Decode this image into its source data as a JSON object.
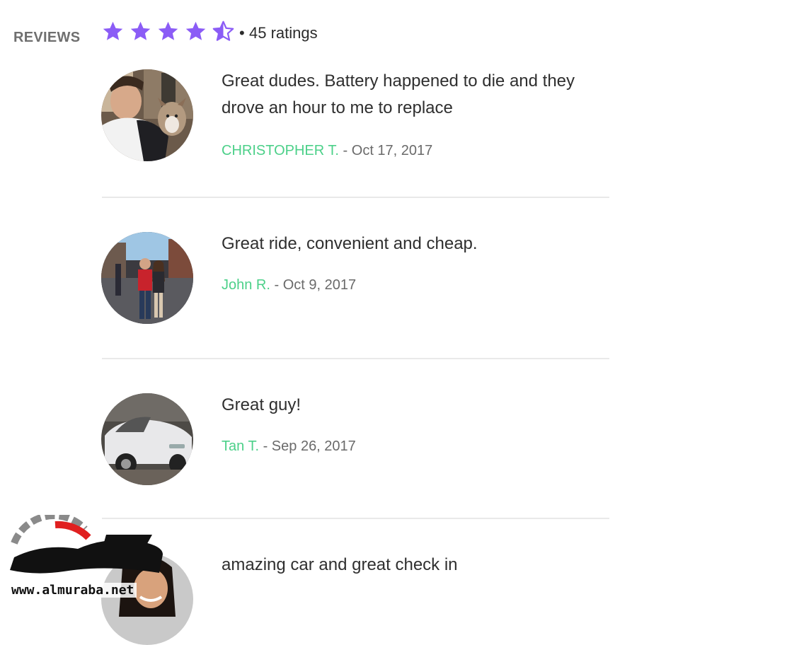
{
  "reviews_section": {
    "label": "REVIEWS",
    "rating": {
      "stars": 4.5,
      "max": 5,
      "color": "#8b5cf6",
      "separator": "•",
      "count_text": "45 ratings"
    }
  },
  "reviews": [
    {
      "avatar_icon": "photo-man-with-dog",
      "text": "Great dudes. Battery happened to die and they drove an hour to me to replace",
      "author": "CHRISTOPHER T.",
      "date": "Oct 17, 2017",
      "dash": "-"
    },
    {
      "avatar_icon": "photo-couple-street",
      "text": "Great ride, convenient and cheap.",
      "author": "John R.",
      "date": "Oct 9, 2017",
      "dash": "-"
    },
    {
      "avatar_icon": "photo-white-convertible-car",
      "text": "Great guy!",
      "author": "Tan T.",
      "date": "Sep 26, 2017",
      "dash": "-"
    },
    {
      "avatar_icon": "photo-woman-portrait",
      "text": "amazing car and great check in",
      "author": "",
      "date": "",
      "dash": ""
    }
  ],
  "colors": {
    "author": "#4cd089",
    "divider": "#e9e9e9",
    "star": "#8b5cf6"
  },
  "watermark": {
    "logo_text": "المربع نت",
    "url": "www.almuraba.net"
  }
}
